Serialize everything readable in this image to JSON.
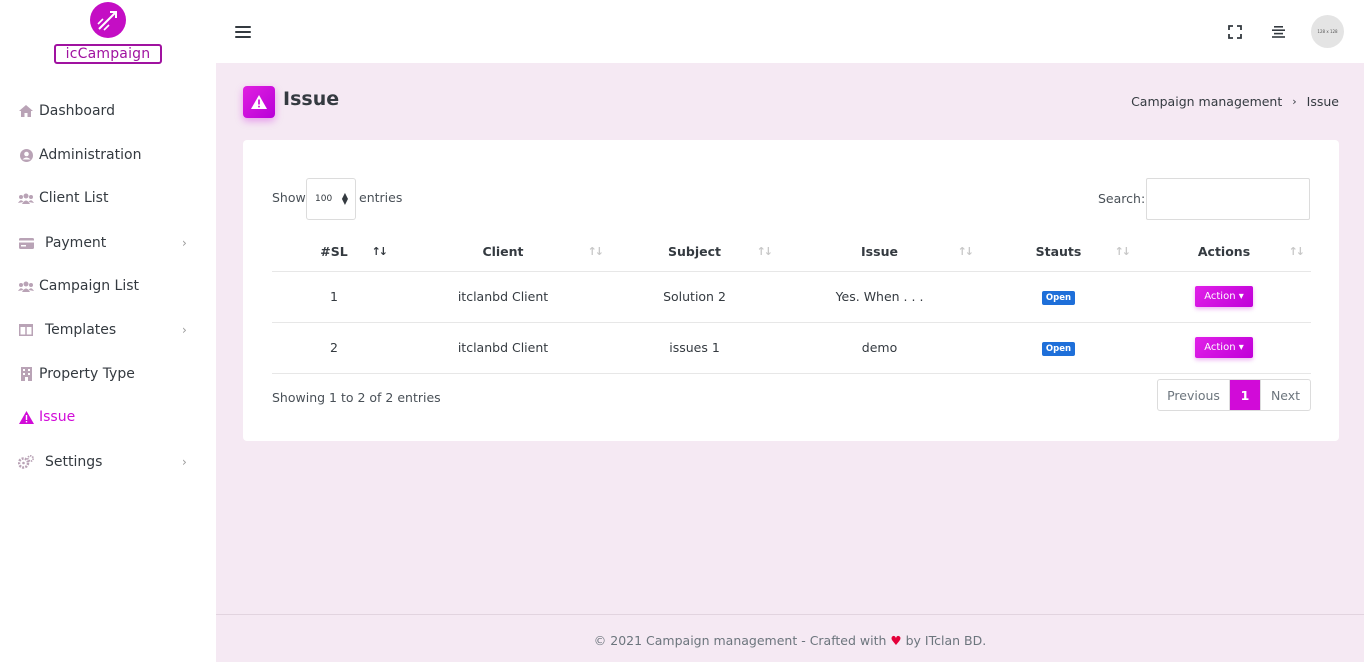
{
  "app": {
    "logo_text": "icCampaign"
  },
  "sidebar": {
    "items": [
      {
        "label": "Dashboard",
        "icon": "home-icon",
        "has_children": false,
        "active": false
      },
      {
        "label": "Administration",
        "icon": "user-circle-icon",
        "has_children": false,
        "active": false
      },
      {
        "label": "Client List",
        "icon": "users-icon",
        "has_children": false,
        "active": false
      },
      {
        "label": "Payment",
        "icon": "credit-card-icon",
        "has_children": true,
        "active": false
      },
      {
        "label": "Campaign List",
        "icon": "users-icon",
        "has_children": false,
        "active": false
      },
      {
        "label": "Templates",
        "icon": "columns-icon",
        "has_children": true,
        "active": false
      },
      {
        "label": "Property Type",
        "icon": "building-icon",
        "has_children": false,
        "active": false
      },
      {
        "label": "Issue",
        "icon": "warning-icon",
        "has_children": false,
        "active": true
      },
      {
        "label": "Settings",
        "icon": "cogs-icon",
        "has_children": true,
        "active": false
      }
    ],
    "chevron": "›"
  },
  "topbar": {
    "avatar_text": "128 x 128"
  },
  "page": {
    "title": "Issue",
    "breadcrumb": {
      "parent": "Campaign management",
      "separator": "›",
      "current": "Issue"
    }
  },
  "table_controls": {
    "show_label": "Show",
    "page_size": "100",
    "entries_label": "entries",
    "search_label": "Search:",
    "search_value": ""
  },
  "table": {
    "columns": [
      "#SL",
      "Client",
      "Subject",
      "Issue",
      "Stauts",
      "Actions"
    ],
    "sorted_column": 0,
    "rows": [
      {
        "sl": "1",
        "client": "itclanbd Client",
        "subject": "Solution 2",
        "issue": "Yes. When . . .",
        "status": "Open",
        "action": "Action"
      },
      {
        "sl": "2",
        "client": "itclanbd Client",
        "subject": "issues 1",
        "issue": "demo",
        "status": "Open",
        "action": "Action"
      }
    ]
  },
  "pagination": {
    "info": "Showing 1 to 2 of 2 entries",
    "previous": "Previous",
    "current": "1",
    "next": "Next"
  },
  "footer": {
    "before": "© 2021 Campaign management - Crafted with",
    "heart": "♥",
    "after": "by ITclan BD."
  },
  "colors": {
    "accent": "#d10bd8",
    "badge": "#1e6fd9",
    "content_bg": "#f5e9f3"
  }
}
